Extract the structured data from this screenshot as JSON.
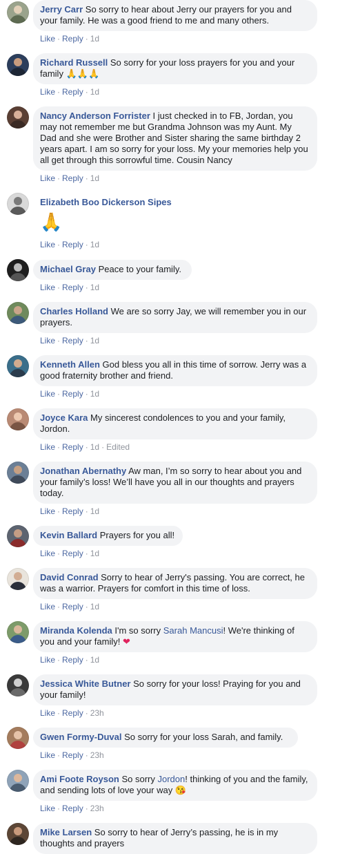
{
  "colors": {
    "name": "#385898",
    "bubble": "#f2f3f5",
    "action": "#4b67a1",
    "meta": "#90949c"
  },
  "actions": {
    "like": "Like",
    "reply": "Reply",
    "separator": "·"
  },
  "comments": [
    {
      "name": "Jerry Carr",
      "text": "So sorry to hear about Jerry our prayers for you and your family. He was a good friend to me and many others.",
      "time": "1d"
    },
    {
      "name": "Richard Russell",
      "text": "So sorry for your loss prayers for you and your family",
      "emoji": "🙏🙏🙏",
      "time": "1d"
    },
    {
      "name": "Nancy Anderson Forrister",
      "text": "I just checked in to FB, Jordan, you may not remember me but Grandma Johnson was my Aunt. My Dad and she were Brother and Sister sharing the same birthday 2 years apart. I am so sorry for your loss. My your memories help you all get through this sorrowful time. Cousin Nancy",
      "time": "1d"
    },
    {
      "name": "Elizabeth Boo Dickerson Sipes",
      "emoji": "🙏",
      "time": "1d"
    },
    {
      "name": "Michael Gray",
      "text": "Peace to your family.",
      "time": "1d"
    },
    {
      "name": "Charles Holland",
      "text": "We are so sorry Jay, we will remember you in our prayers.",
      "time": "1d"
    },
    {
      "name": "Kenneth Allen",
      "text": "God bless you all in this time of sorrow. Jerry was a good fraternity brother and friend.",
      "time": "1d"
    },
    {
      "name": "Joyce Kara",
      "text": "My sincerest condolences to you and your family, Jordon.",
      "time": "1d",
      "edited": "Edited"
    },
    {
      "name": "Jonathan Abernathy",
      "text": "Aw man, I’m so sorry to hear about you and your family’s loss! We’ll have you all in our thoughts and prayers today.",
      "time": "1d"
    },
    {
      "name": "Kevin Ballard",
      "text": "Prayers for you all!",
      "time": "1d"
    },
    {
      "name": "David Conrad",
      "text": "Sorry to hear of Jerry's passing. You are correct, he was a warrior. Prayers for comfort in this time of loss.",
      "time": "1d"
    },
    {
      "name": "Miranda Kolenda",
      "pre": "I'm so sorry",
      "mention": "Sarah Mancusi",
      "post": "! We're thinking of you and your family!",
      "heart": "❤",
      "time": "1d"
    },
    {
      "name": "Jessica White Butner",
      "text": "So sorry for your loss! Praying for you and your family!",
      "time": "23h"
    },
    {
      "name": "Gwen Formy-Duval",
      "text": "So sorry for your loss Sarah, and family.",
      "time": "23h"
    },
    {
      "name": "Ami Foote Royson",
      "pre": "So sorry",
      "mention": "Jordon",
      "post": "! thinking of you and the family, and sending lots of love your way",
      "emoji": "😘",
      "time": "23h"
    },
    {
      "name": "Mike Larsen",
      "text": "So sorry to hear of Jerry’s passing, he is in my thoughts and prayers"
    }
  ]
}
